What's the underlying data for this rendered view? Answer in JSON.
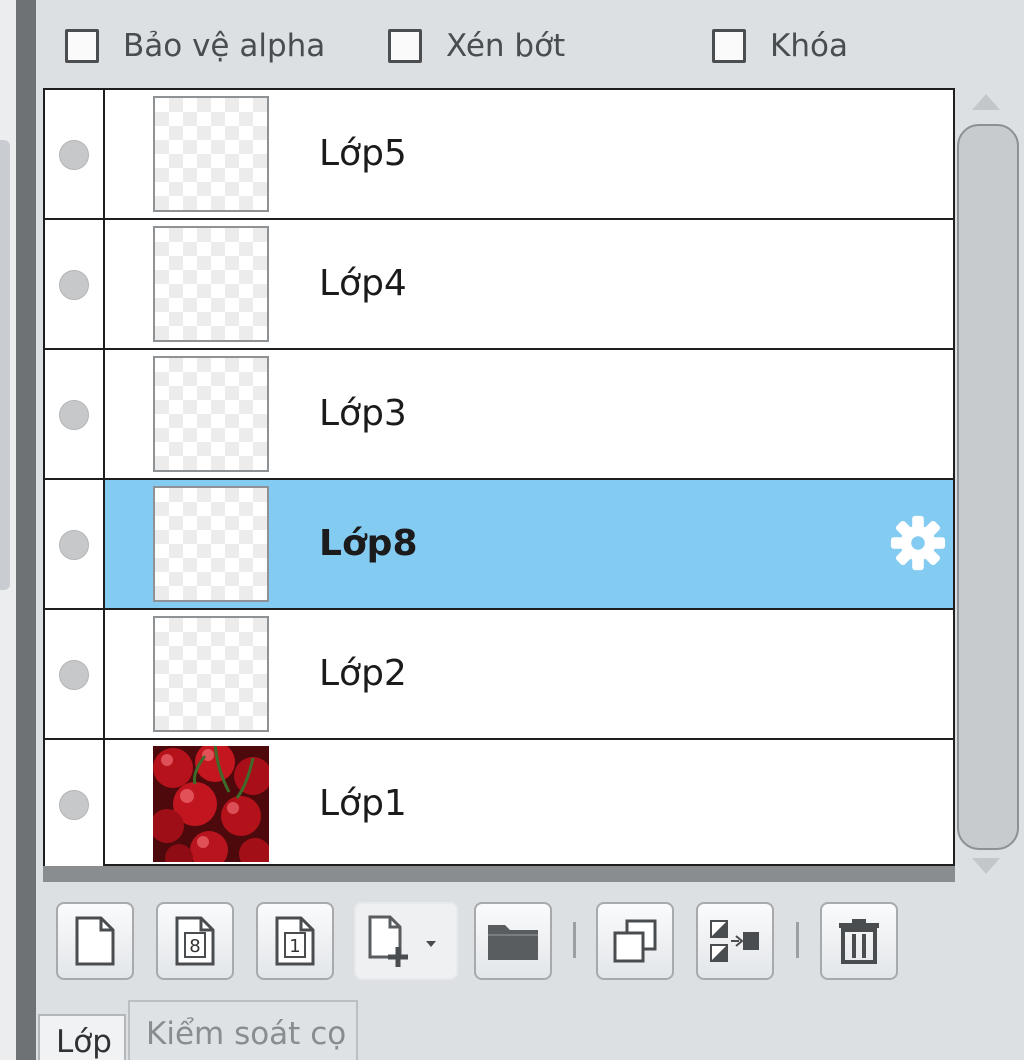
{
  "options": [
    {
      "label": "Bảo vệ alpha",
      "checked": false
    },
    {
      "label": "Xén bớt",
      "checked": false
    },
    {
      "label": "Khóa",
      "checked": false
    }
  ],
  "layers": [
    {
      "name": "Lớp5",
      "selected": false,
      "thumbnail": "transparent"
    },
    {
      "name": "Lớp4",
      "selected": false,
      "thumbnail": "transparent"
    },
    {
      "name": "Lớp3",
      "selected": false,
      "thumbnail": "transparent"
    },
    {
      "name": "Lớp8",
      "selected": true,
      "thumbnail": "transparent",
      "status_icon": "gear-icon"
    },
    {
      "name": "Lớp2",
      "selected": false,
      "thumbnail": "transparent"
    },
    {
      "name": "Lớp1",
      "selected": false,
      "thumbnail": "cherries-photo"
    }
  ],
  "toolbar": {
    "buttons": [
      {
        "icon": "new-layer-icon"
      },
      {
        "icon": "page-8-icon",
        "badge": "8"
      },
      {
        "icon": "page-1-icon",
        "badge": "1"
      },
      {
        "icon": "add-layer-dropdown-icon"
      },
      {
        "icon": "folder-icon"
      },
      {
        "icon": "duplicate-icon"
      },
      {
        "icon": "merge-icon"
      },
      {
        "icon": "trash-icon"
      }
    ]
  },
  "tabs": [
    {
      "label": "Lớp",
      "active": true
    },
    {
      "label": "Kiểm soát cọ",
      "active": false
    }
  ],
  "colors": {
    "selection": "#84cbf1",
    "panel": "#dde0e3",
    "border": "#1f1f1f"
  }
}
